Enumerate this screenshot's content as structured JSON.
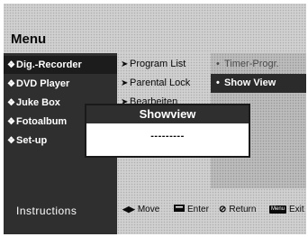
{
  "menu": {
    "title": "Menu"
  },
  "column1": {
    "items": [
      {
        "label": "Dig.-Recorder",
        "selected": true
      },
      {
        "label": "DVD Player"
      },
      {
        "label": "Juke Box"
      },
      {
        "label": "Fotoalbum"
      },
      {
        "label": "Set-up"
      }
    ]
  },
  "column2": {
    "items": [
      {
        "label": "Program List"
      },
      {
        "label": "Parental Lock"
      },
      {
        "label": "Bearbeiten"
      }
    ]
  },
  "column3": {
    "items": [
      {
        "label": "Timer-Progr."
      },
      {
        "label": "Show View",
        "selected": true
      }
    ]
  },
  "popup": {
    "title": "Showview",
    "value": "---------"
  },
  "footer": {
    "instructions_label": "Instructions",
    "hints": {
      "move": "Move",
      "enter": "Enter",
      "return": "Return",
      "exit": "Exit",
      "exit_key": "Menu"
    }
  },
  "icons": [
    "diamond-bullet-icon",
    "arrow-bullet-icon",
    "dot-bullet-icon",
    "move-arrows-icon",
    "enter-key-icon",
    "return-key-icon",
    "menu-key-icon"
  ]
}
